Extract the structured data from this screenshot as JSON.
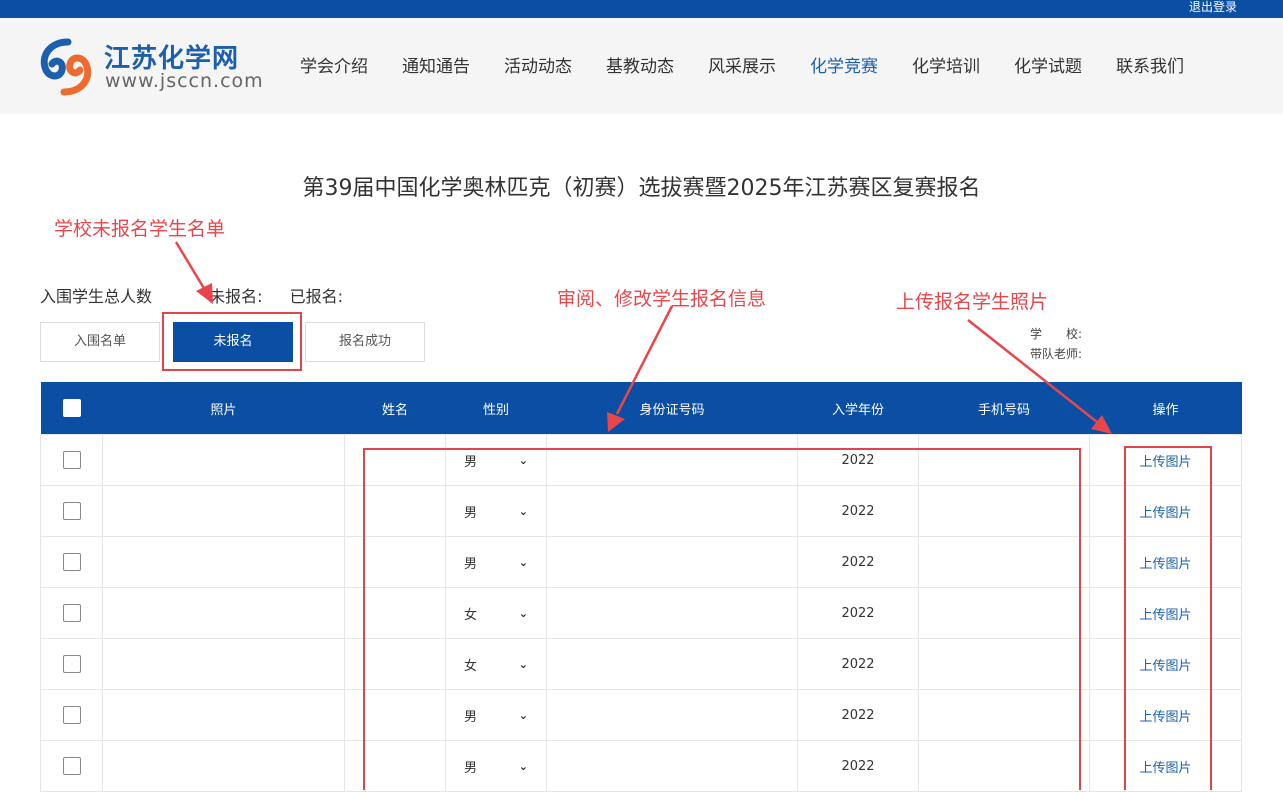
{
  "topbar": {
    "logout_label": "退出登录",
    "brand_color": "#0a4fa3"
  },
  "logo": {
    "title": "江苏化学网",
    "url": "www.jsccn.com"
  },
  "nav": [
    {
      "label": "学会介绍",
      "active": false
    },
    {
      "label": "通知通告",
      "active": false
    },
    {
      "label": "活动动态",
      "active": false
    },
    {
      "label": "基教动态",
      "active": false
    },
    {
      "label": "风采展示",
      "active": false
    },
    {
      "label": "化学竞赛",
      "active": true
    },
    {
      "label": "化学培训",
      "active": false
    },
    {
      "label": "化学试题",
      "active": false
    },
    {
      "label": "联系我们",
      "active": false
    }
  ],
  "page_title": "第39届中国化学奥林匹克（初赛）选拔赛暨2025年江苏赛区复赛报名",
  "annotations": {
    "unregistered_list": "学校未报名学生名单",
    "review_edit": "审阅、修改学生报名信息",
    "upload_photo": "上传报名学生照片",
    "color": "#e8464b"
  },
  "stats": {
    "total_label": "入围学生总人数",
    "unregistered_label": "未报名:",
    "registered_label": "已报名:"
  },
  "tabs": [
    {
      "label": "入围名单",
      "active": false
    },
    {
      "label": "未报名",
      "active": true
    },
    {
      "label": "报名成功",
      "active": false
    }
  ],
  "school_info": {
    "school_label": "学　　校:",
    "teacher_label": "带队老师:"
  },
  "table": {
    "columns": [
      "照片",
      "姓名",
      "性别",
      "身份证号码",
      "入学年份",
      "手机号码",
      "操作"
    ],
    "action_label": "上传图片",
    "rows": [
      {
        "gender": "男",
        "year": "2022"
      },
      {
        "gender": "男",
        "year": "2022"
      },
      {
        "gender": "男",
        "year": "2022"
      },
      {
        "gender": "女",
        "year": "2022"
      },
      {
        "gender": "女",
        "year": "2022"
      },
      {
        "gender": "男",
        "year": "2022"
      },
      {
        "gender": "男",
        "year": "2022"
      }
    ]
  }
}
